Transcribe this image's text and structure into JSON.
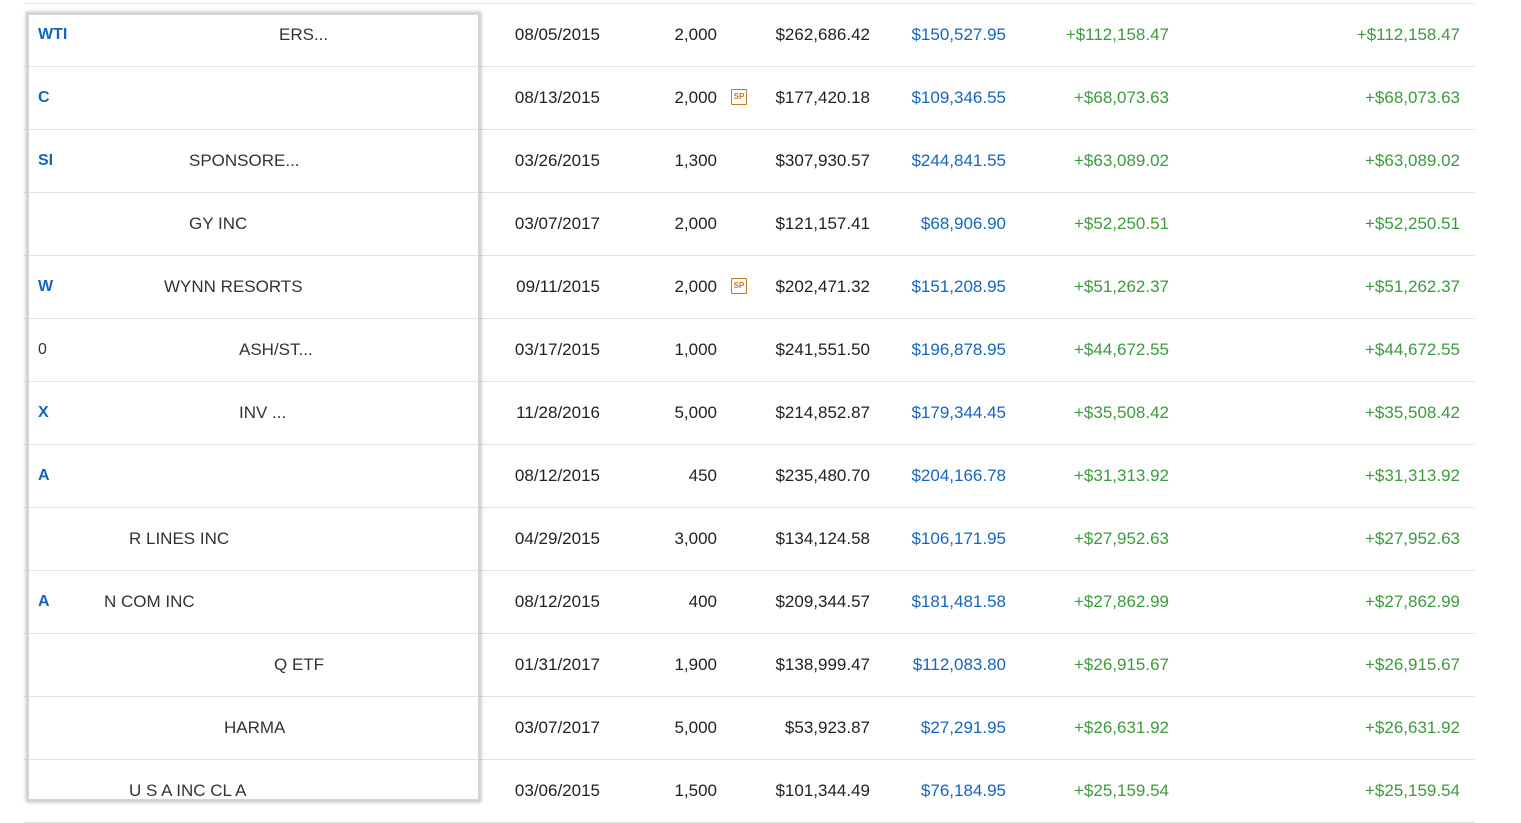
{
  "rows": [
    {
      "symbol": "WTI",
      "desc": "ERS...",
      "date": "08/05/2015",
      "qty": "2,000",
      "badge": false,
      "cost": "$262,686.42",
      "value": "$150,527.95",
      "gain": "+$112,158.47",
      "total_gain": "+$112,158.47"
    },
    {
      "symbol": "C",
      "desc": "",
      "date": "08/13/2015",
      "qty": "2,000",
      "badge": true,
      "cost": "$177,420.18",
      "value": "$109,346.55",
      "gain": "+$68,073.63",
      "total_gain": "+$68,073.63"
    },
    {
      "symbol": "SI",
      "desc": "SPONSORE...",
      "date": "03/26/2015",
      "qty": "1,300",
      "badge": false,
      "cost": "$307,930.57",
      "value": "$244,841.55",
      "gain": "+$63,089.02",
      "total_gain": "+$63,089.02"
    },
    {
      "symbol": "",
      "desc": "GY INC",
      "date": "03/07/2017",
      "qty": "2,000",
      "badge": false,
      "cost": "$121,157.41",
      "value": "$68,906.90",
      "gain": "+$52,250.51",
      "total_gain": "+$52,250.51"
    },
    {
      "symbol": "W",
      "desc": "WYNN RESORTS",
      "date": "09/11/2015",
      "qty": "2,000",
      "badge": true,
      "cost": "$202,471.32",
      "value": "$151,208.95",
      "gain": "+$51,262.37",
      "total_gain": "+$51,262.37"
    },
    {
      "symbol": "0",
      "desc": "ASH/ST...",
      "date": "03/17/2015",
      "qty": "1,000",
      "badge": false,
      "cost": "$241,551.50",
      "value": "$196,878.95",
      "gain": "+$44,672.55",
      "total_gain": "+$44,672.55"
    },
    {
      "symbol": "X",
      "desc": "INV ...",
      "date": "11/28/2016",
      "qty": "5,000",
      "badge": false,
      "cost": "$214,852.87",
      "value": "$179,344.45",
      "gain": "+$35,508.42",
      "total_gain": "+$35,508.42"
    },
    {
      "symbol": "A",
      "desc": "",
      "date": "08/12/2015",
      "qty": "450",
      "badge": false,
      "cost": "$235,480.70",
      "value": "$204,166.78",
      "gain": "+$31,313.92",
      "total_gain": "+$31,313.92"
    },
    {
      "symbol": "",
      "desc": "R LINES INC",
      "date": "04/29/2015",
      "qty": "3,000",
      "badge": false,
      "cost": "$134,124.58",
      "value": "$106,171.95",
      "gain": "+$27,952.63",
      "total_gain": "+$27,952.63"
    },
    {
      "symbol": "A",
      "desc": "N COM INC",
      "date": "08/12/2015",
      "qty": "400",
      "badge": false,
      "cost": "$209,344.57",
      "value": "$181,481.58",
      "gain": "+$27,862.99",
      "total_gain": "+$27,862.99"
    },
    {
      "symbol": "",
      "desc": "Q ETF",
      "date": "01/31/2017",
      "qty": "1,900",
      "badge": false,
      "cost": "$138,999.47",
      "value": "$112,083.80",
      "gain": "+$26,915.67",
      "total_gain": "+$26,915.67"
    },
    {
      "symbol": "",
      "desc": "HARMA",
      "date": "03/07/2017",
      "qty": "5,000",
      "badge": false,
      "cost": "$53,923.87",
      "value": "$27,291.95",
      "gain": "+$26,631.92",
      "total_gain": "+$26,631.92"
    },
    {
      "symbol": "",
      "desc": "U S A INC CL A",
      "date": "03/06/2015",
      "qty": "1,500",
      "badge": false,
      "cost": "$101,344.49",
      "value": "$76,184.95",
      "gain": "+$25,159.54",
      "total_gain": "+$25,159.54"
    }
  ],
  "badge_text": "SP"
}
